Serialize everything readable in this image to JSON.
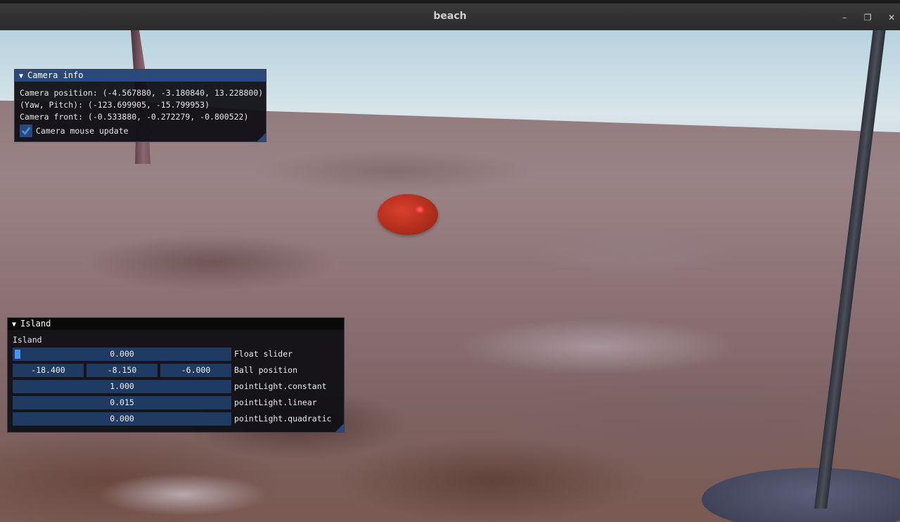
{
  "window": {
    "title": "beach",
    "minimize_glyph": "–",
    "maximize_glyph": "❐",
    "close_glyph": "✕"
  },
  "camera_info": {
    "title": "Camera info",
    "position_line": "Camera position: (-4.567880, -3.180840, 13.228800)",
    "yaw_pitch_line": "(Yaw, Pitch): (-123.699905, -15.799953)",
    "front_line": "Camera front: (-0.533880, -0.272279, -0.800522)",
    "mouse_update_label": "Camera mouse update",
    "mouse_update_checked": true
  },
  "island": {
    "title": "Island",
    "section_text": "Island",
    "float_slider": {
      "value": "0.000",
      "label": "Float slider",
      "fraction": 0.0
    },
    "ball_position": {
      "x": "-18.400",
      "y": "-8.150",
      "z": "-6.000",
      "label": "Ball position"
    },
    "point_light_constant": {
      "value": "1.000",
      "label": "pointLight.constant"
    },
    "point_light_linear": {
      "value": "0.015",
      "label": "pointLight.linear"
    },
    "point_light_quadratic": {
      "value": "0.000",
      "label": "pointLight.quadratic"
    }
  },
  "colors": {
    "imgui_title_active": "#294a7a",
    "imgui_frame": "#1f3a63",
    "imgui_grab": "#4296fa",
    "ball_red": "#d8402c"
  }
}
